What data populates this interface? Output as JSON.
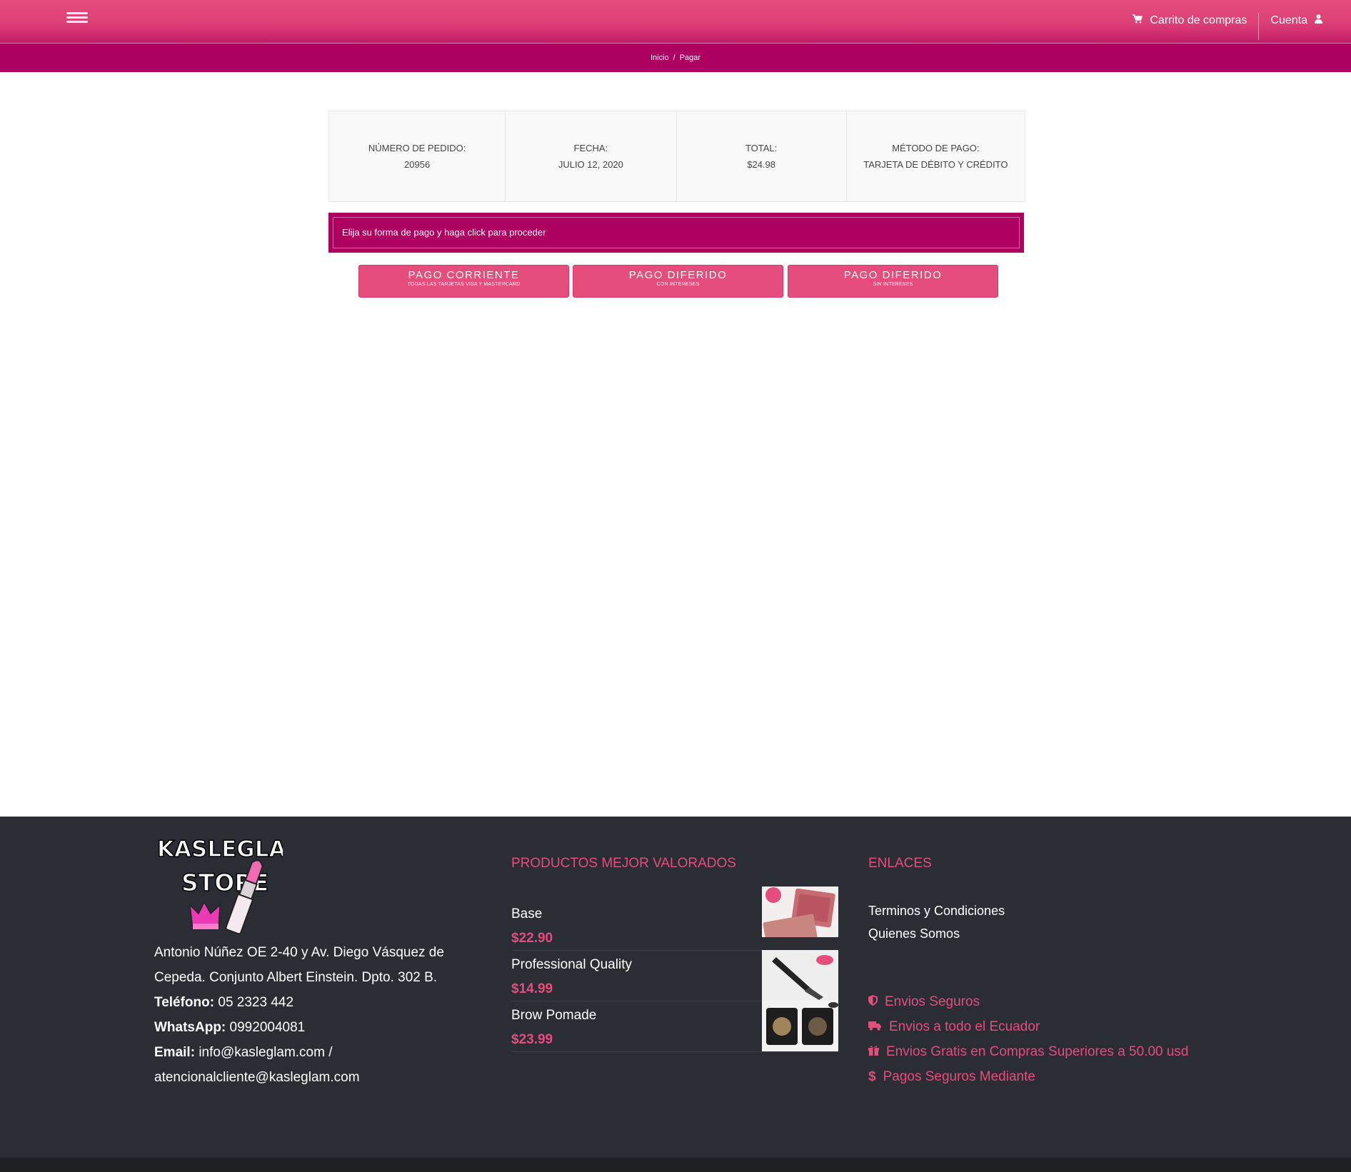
{
  "nav": {
    "cart_label": "Carrito de compras",
    "account_label": "Cuenta"
  },
  "breadcrumb": {
    "home": "Inicio",
    "separator": "/",
    "current": "Pagar"
  },
  "order": {
    "number_label": "NÚMERO DE PEDIDO:",
    "number": "20956",
    "date_label": "FECHA:",
    "date": "JULIO 12, 2020",
    "total_label": "TOTAL:",
    "total": "$24.98",
    "method_label": "MÉTODO DE PAGO:",
    "method": "TARJETA DE DÉBITO Y CRÉDITO"
  },
  "notice": "Elija su forma de pago y haga click para proceder",
  "payment_buttons": [
    {
      "title": "PAGO CORRIENTE",
      "subtitle": "TODAS LAS TARJETAS VISA Y MASTERCARD"
    },
    {
      "title": "PAGO DIFERIDO",
      "subtitle": "CON INTERESES"
    },
    {
      "title": "PAGO DIFERIDO",
      "subtitle": "SIN INTERESES"
    }
  ],
  "footer": {
    "logo_text_1": "KASLEGLAM",
    "logo_text_2": "STORE",
    "address_1": "Antonio Núñez OE 2-40 y Av. Diego Vásquez de",
    "address_2": "Cepeda. Conjunto Albert Einstein. Dpto. 302 B.",
    "phone_label": "Teléfono:",
    "phone": "05 2323 442",
    "whatsapp_label": "WhatsApp:",
    "whatsapp": "0992004081",
    "email_label": "Email:",
    "email_1": "info@kasleglam.com /",
    "email_2": "atencionalcliente@kasleglam.com",
    "products_title": "PRODUCTOS MEJOR VALORADOS",
    "products": [
      {
        "name": "Base",
        "price": "$22.90"
      },
      {
        "name": "Professional Quality",
        "price": "$14.99"
      },
      {
        "name": "Brow Pomade",
        "price": "$23.99"
      }
    ],
    "links_title": "ENLACES",
    "links": [
      "Terminos y Condiciones",
      "Quienes Somos"
    ],
    "features": [
      {
        "icon": "shield-icon",
        "text": "Envios Seguros"
      },
      {
        "icon": "truck-icon",
        "text": "Envios a todo el Ecuador"
      },
      {
        "icon": "gift-icon",
        "text": "Envios Gratis en Compras Superiores a 50.00 usd"
      },
      {
        "icon": "dollar-icon",
        "text": "Pagos Seguros Mediante"
      }
    ]
  },
  "colors": {
    "brand_pink": "#e54d7c",
    "brand_magenta": "#ad0061",
    "footer_bg": "#2a2d33"
  }
}
